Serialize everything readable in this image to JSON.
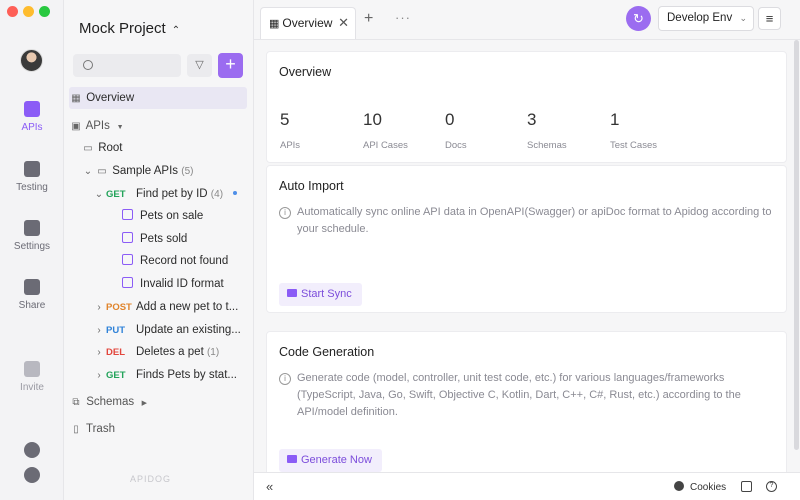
{
  "window": {
    "controls": [
      "close",
      "minimize",
      "maximize"
    ]
  },
  "rail": {
    "items": [
      {
        "label": "APIs",
        "icon": "apis-icon",
        "active": true
      },
      {
        "label": "Testing",
        "icon": "testing-icon"
      },
      {
        "label": "Settings",
        "icon": "settings-icon"
      },
      {
        "label": "Share",
        "icon": "share-icon"
      },
      {
        "label": "Invite",
        "icon": "invite-icon"
      }
    ],
    "bottom_icons": [
      "notifications-icon",
      "gear-icon"
    ]
  },
  "sidebar": {
    "project_name": "Mock Project",
    "tree": {
      "overview": "Overview",
      "apis": "APIs",
      "root": "Root",
      "folder": {
        "name": "Sample APIs",
        "count": "(5)"
      },
      "endpoints": [
        {
          "method": "GET",
          "name": "Find pet by ID",
          "count": "(4)"
        },
        {
          "method": "POST",
          "name": "Add a new pet to t..."
        },
        {
          "method": "PUT",
          "name": "Update an existing..."
        },
        {
          "method": "DEL",
          "name": "Deletes a pet",
          "count": "(1)"
        },
        {
          "method": "GET",
          "name": "Finds Pets by stat..."
        }
      ],
      "cases": [
        "Pets on sale",
        "Pets sold",
        "Record not found",
        "Invalid ID format"
      ],
      "schemas": "Schemas",
      "trash": "Trash"
    },
    "brand": "APIDOG"
  },
  "tabs": {
    "active": "Overview",
    "environment": "Develop Env"
  },
  "overview": {
    "title": "Overview",
    "stats": [
      {
        "value": "5",
        "label": "APIs"
      },
      {
        "value": "10",
        "label": "API Cases"
      },
      {
        "value": "0",
        "label": "Docs"
      },
      {
        "value": "3",
        "label": "Schemas"
      },
      {
        "value": "1",
        "label": "Test Cases"
      }
    ]
  },
  "auto_import": {
    "title": "Auto Import",
    "description": "Automatically sync online API data in OpenAPI(Swagger) or apiDoc format to Apidog according to your schedule.",
    "action": "Start Sync"
  },
  "code_generation": {
    "title": "Code Generation",
    "description": "Generate code (model, controller, unit test code, etc.) for various languages/frameworks (TypeScript, Java, Go, Swift, Objective C, Kotlin, Dart, C++, C#, Rust, etc.) according to the API/model definition.",
    "action": "Generate Now"
  },
  "bottombar": {
    "cookies": "Cookies"
  },
  "colors": {
    "accent": "#8b5cf6",
    "get": "#22a35a",
    "post": "#e0842b",
    "put": "#2f82d8",
    "delete": "#e2463d"
  }
}
